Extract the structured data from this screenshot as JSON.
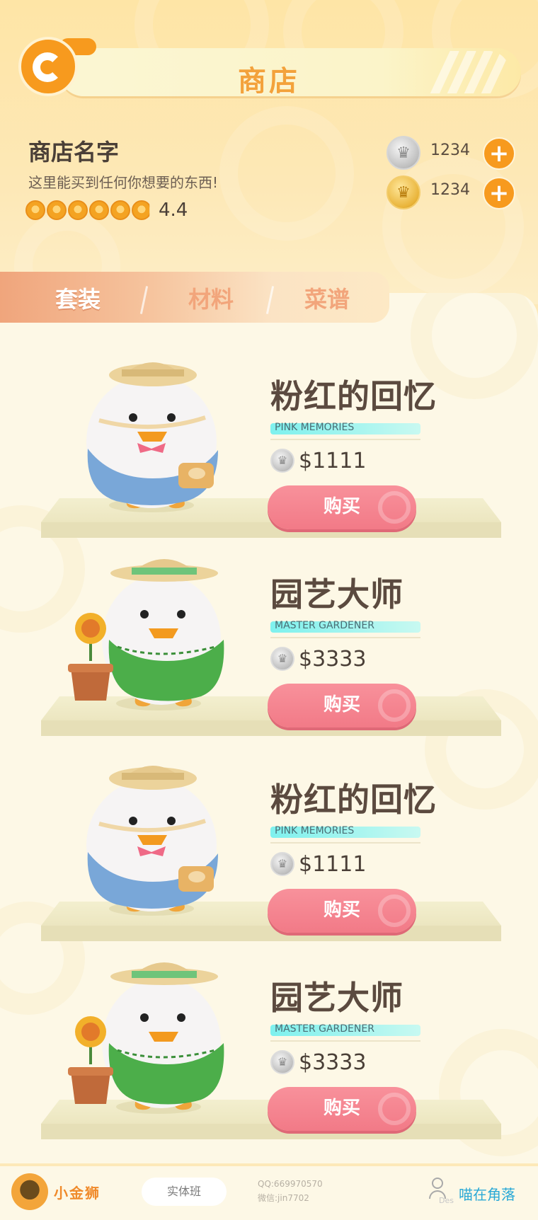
{
  "header": {
    "title": "商店",
    "back_icon": "back-icon"
  },
  "shop": {
    "name": "商店名字",
    "description": "这里能买到任何你想要的东西!",
    "rating": "4.4",
    "rating_value": 4.4,
    "rating_max": 5
  },
  "currency": [
    {
      "type": "silver",
      "icon": "silver-crown-coin-icon",
      "amount": "1234"
    },
    {
      "type": "gold",
      "icon": "gold-crown-coin-icon",
      "amount": "1234"
    }
  ],
  "tabs": [
    {
      "label": "套装",
      "active": true
    },
    {
      "label": "材料",
      "active": false
    },
    {
      "label": "菜谱",
      "active": false
    }
  ],
  "products": [
    {
      "name": "粉红的回忆",
      "subtitle": "PINK MEMORIES",
      "price": "$1111",
      "buy_label": "购买",
      "figure": "duck-with-hat-and-bag"
    },
    {
      "name": "园艺大师",
      "subtitle": "MASTER GARDENER",
      "price": "$3333",
      "buy_label": "购买",
      "figure": "duck-gardener-with-flower-pot"
    },
    {
      "name": "粉红的回忆",
      "subtitle": "PINK MEMORIES",
      "price": "$1111",
      "buy_label": "购买",
      "figure": "duck-with-hat-and-bag"
    },
    {
      "name": "园艺大师",
      "subtitle": "MASTER GARDENER",
      "price": "$3333",
      "buy_label": "购买",
      "figure": "duck-gardener-with-flower-pot"
    }
  ],
  "watermark": {
    "brand": "小金狮",
    "tag": "实体班",
    "qq": "QQ:669970570",
    "wechat": "微信:jin7702",
    "des": "Des",
    "author": "喵在角落"
  },
  "colors": {
    "accent_orange": "#f79a1e",
    "title_orange": "#f3a23b",
    "buy_pink": "#f27a87",
    "subtitle_cyan": "#7ef1ee",
    "background": "#fdf8e6"
  }
}
